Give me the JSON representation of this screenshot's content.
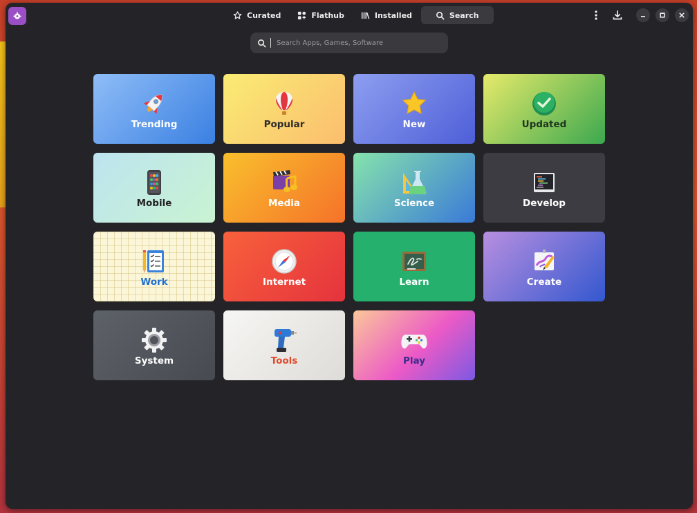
{
  "window": {
    "tabs": [
      {
        "label": "Curated",
        "icon": "star-icon"
      },
      {
        "label": "Flathub",
        "icon": "flathub-icon"
      },
      {
        "label": "Installed",
        "icon": "library-icon"
      },
      {
        "label": "Search",
        "icon": "search-icon",
        "active": true
      }
    ],
    "controls": [
      "menu-icon",
      "download-icon",
      "minimize-icon",
      "maximize-icon",
      "close-icon"
    ]
  },
  "search": {
    "placeholder": "Search Apps, Games, Software",
    "value": ""
  },
  "categories": [
    {
      "label": "Trending",
      "icon": "rocket-icon"
    },
    {
      "label": "Popular",
      "icon": "balloon-icon"
    },
    {
      "label": "New",
      "icon": "star-icon"
    },
    {
      "label": "Updated",
      "icon": "check-badge-icon"
    },
    {
      "label": "Mobile",
      "icon": "phone-icon"
    },
    {
      "label": "Media",
      "icon": "clapper-music-icon"
    },
    {
      "label": "Science",
      "icon": "flask-icon"
    },
    {
      "label": "Develop",
      "icon": "code-monitor-icon"
    },
    {
      "label": "Work",
      "icon": "checklist-icon"
    },
    {
      "label": "Internet",
      "icon": "compass-icon"
    },
    {
      "label": "Learn",
      "icon": "chalkboard-icon"
    },
    {
      "label": "Create",
      "icon": "canvas-icon"
    },
    {
      "label": "System",
      "icon": "gear-icon"
    },
    {
      "label": "Tools",
      "icon": "drill-icon"
    },
    {
      "label": "Play",
      "icon": "gamepad-icon"
    }
  ],
  "colors": {
    "window_bg": "#242428",
    "app_badge": "#9b4fc6",
    "active_tab": "#3a3a3f"
  }
}
